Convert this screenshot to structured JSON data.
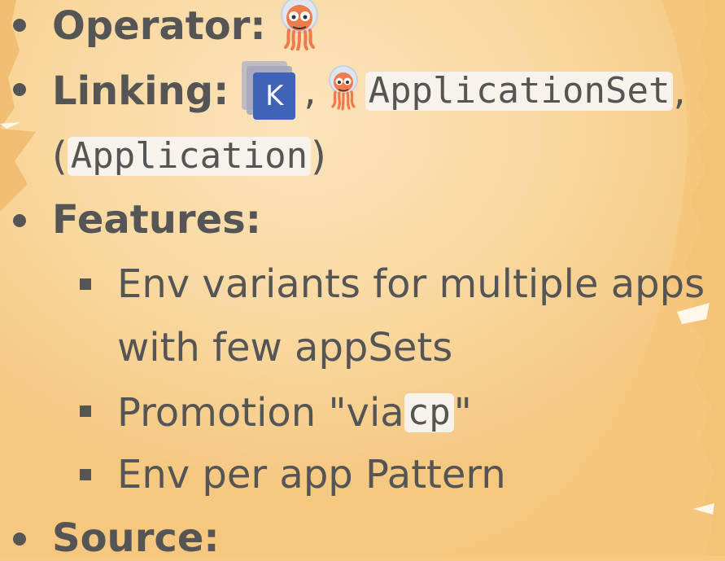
{
  "list": {
    "operator_label": "Operator:",
    "linking_label": "Linking:",
    "k_icon_letter": "K",
    "comma": ",",
    "applicationset_code": "ApplicationSet",
    "trailing_comma": ",",
    "paren_open": "(",
    "application_code": "Application",
    "paren_close": ")",
    "features_label": "Features:",
    "feature_1_line_1": "Env variants for multiple apps",
    "feature_1_line_2": "with few appSets",
    "feature_2_prefix": "Promotion \"via ",
    "feature_2_code": "cp",
    "feature_2_suffix": "\"",
    "feature_3": "Env per app Pattern",
    "source_label": "Source:"
  },
  "icons": {
    "operator_icon": "argo-octopus-icon",
    "linking_k_icon": "k-square-icon",
    "linking_octopus_icon": "argo-octopus-icon"
  }
}
